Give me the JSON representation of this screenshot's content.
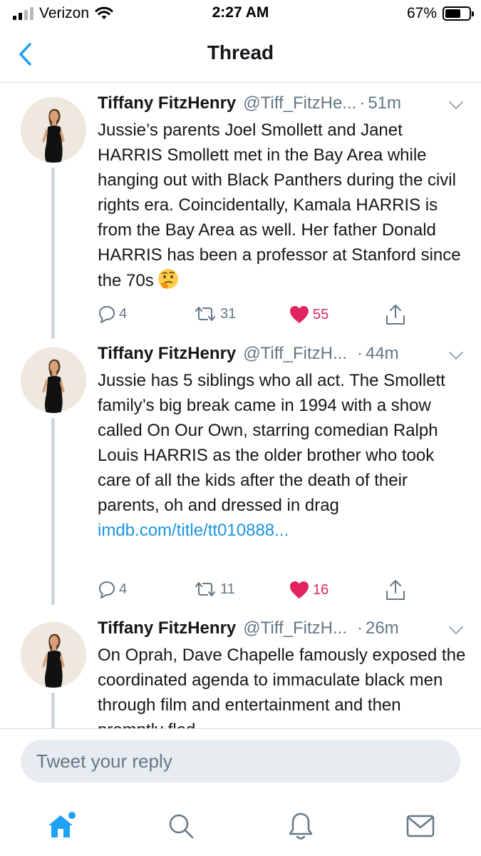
{
  "status_bar": {
    "carrier": "Verizon",
    "time": "2:27 AM",
    "battery_percent": "67%",
    "battery_level": 0.67
  },
  "nav": {
    "title": "Thread",
    "back_icon": "chevron-left-icon"
  },
  "tweets": [
    {
      "author": "Tiffany FitzHenry",
      "handle": "@Tiff_FitzHe...",
      "separator": "·",
      "time": "51m",
      "text": "Jussie’s parents Joel Smollett and Janet HARRIS Smollett met in the Bay Area while hanging out with Black Panthers during the civil rights era. Coincidentally, Kamala HARRIS is from the Bay Area as well. Her father Donald HARRIS has been a professor at Stanford since the 70s",
      "emoji": "thinking-face-emoji",
      "link": "",
      "replies": "4",
      "retweets": "31",
      "likes": "55"
    },
    {
      "author": "Tiffany FitzHenry",
      "handle": "@Tiff_FitzH...",
      "separator": "·",
      "time": "44m",
      "text": "Jussie has 5 siblings who all act. The Smollett family’s big break came in 1994 with a show called On Our Own, starring comedian Ralph Louis HARRIS as the older brother who took care of all the kids after the death of their parents, oh and dressed in drag",
      "link": "imdb.com/title/tt010888...",
      "replies": "4",
      "retweets": "11",
      "likes": "16"
    },
    {
      "author": "Tiffany FitzHenry",
      "handle": "@Tiff_FitzH...",
      "separator": "·",
      "time": "26m",
      "text": "On Oprah, Dave Chapelle famously exposed the coordinated agenda to immaculate black men through film and entertainment and then promptly fled",
      "link": ""
    }
  ],
  "reply": {
    "placeholder": "Tweet your reply"
  },
  "tab_bar": {
    "tabs": [
      "home-icon",
      "search-icon",
      "notifications-bell-icon",
      "messages-envelope-icon"
    ],
    "active": "home-icon",
    "accent_color": "#1da1f2"
  },
  "colors": {
    "text": "#14171a",
    "secondary": "#657786",
    "link": "#1b95e0",
    "like": "#e0245e",
    "accent": "#1da1f2"
  }
}
